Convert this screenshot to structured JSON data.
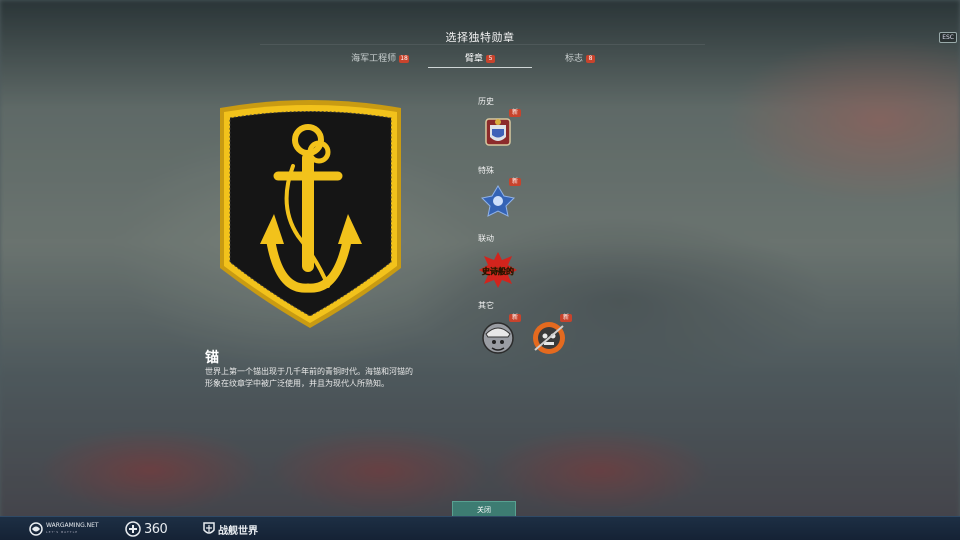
{
  "header": {
    "title": "选择独特勋章",
    "esc_label": "ESC"
  },
  "tabs": [
    {
      "label": "海军工程师",
      "count": "18"
    },
    {
      "label": "臂章",
      "count": "5"
    },
    {
      "label": "标志",
      "count": "8"
    }
  ],
  "selected_item": {
    "name": "锚",
    "description": "世界上第一个锚出现于几千年前的青铜时代。海锚和河锚的形象在纹章学中被广泛使用，并且为现代人所熟知。"
  },
  "categories": [
    {
      "label": "历史",
      "items": [
        {
          "icon": "heraldic-shield-icon",
          "badge": "新"
        }
      ]
    },
    {
      "label": "特殊",
      "items": [
        {
          "icon": "blue-emblem-icon",
          "badge": "新"
        }
      ]
    },
    {
      "label": "联动",
      "items": [
        {
          "icon": "epic-comic-icon",
          "text": "史诗般的"
        }
      ]
    },
    {
      "label": "其它",
      "items": [
        {
          "icon": "marine-character-icon",
          "badge": "新"
        },
        {
          "icon": "skull-diver-icon",
          "badge": "新"
        }
      ]
    }
  ],
  "close_label": "关闭",
  "footer": {
    "wargaming": "WARGAMING.NET",
    "wargaming_sub": "LET'S BATTLE",
    "platform": "360",
    "game": "战舰世界"
  },
  "colors": {
    "badge": "#c8432c",
    "emblem_gold": "#f2c21b",
    "emblem_black": "#151515",
    "close_button": "#3d7c72",
    "footer": "#1d2f44"
  }
}
